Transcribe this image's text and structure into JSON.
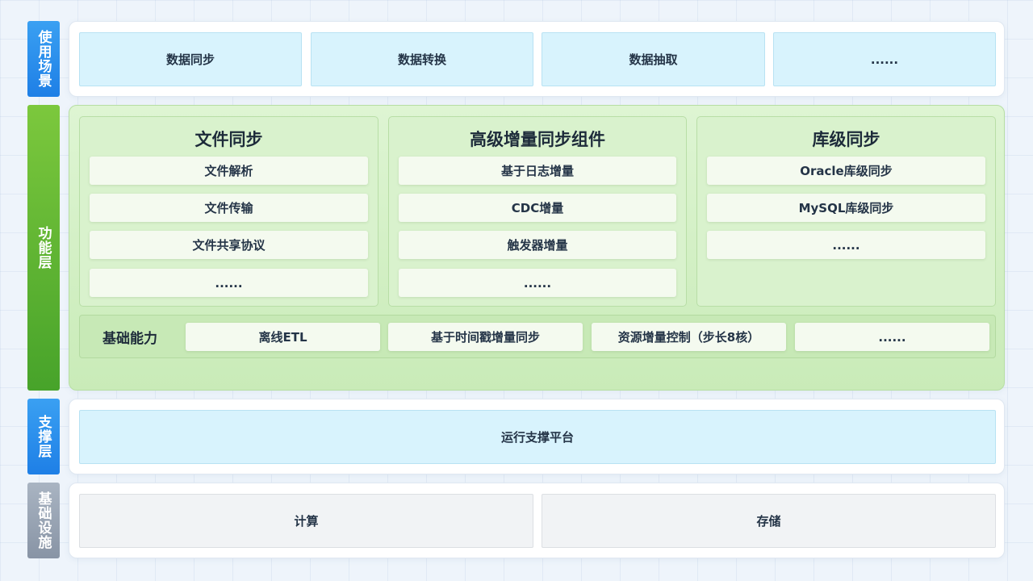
{
  "layers": {
    "usage": {
      "label": "使用场景",
      "items": [
        "数据同步",
        "数据转换",
        "数据抽取",
        "......"
      ]
    },
    "function": {
      "label": "功能层",
      "columns": [
        {
          "title": "文件同步",
          "items": [
            "文件解析",
            "文件传输",
            "文件共享协议",
            "......"
          ]
        },
        {
          "title": "高级增量同步组件",
          "items": [
            "基于日志增量",
            "CDC增量",
            "触发器增量",
            "......"
          ]
        },
        {
          "title": "库级同步",
          "items": [
            "Oracle库级同步",
            "MySQL库级同步",
            "......"
          ]
        }
      ],
      "basic": {
        "label": "基础能力",
        "items": [
          "离线ETL",
          "基于时间戳增量同步",
          "资源增量控制（步长8核）",
          "......"
        ]
      }
    },
    "support": {
      "label": "支撑层",
      "items": [
        "运行支撑平台"
      ]
    },
    "infra": {
      "label": "基础设施",
      "items": [
        "计算",
        "存储"
      ]
    }
  },
  "colors": {
    "blue_label": "#1e7fe6",
    "green_label": "#47a32a",
    "grey_label": "#8894a5",
    "blue_box": "#d8f3fd",
    "green_panel": "#c9ebb8"
  }
}
